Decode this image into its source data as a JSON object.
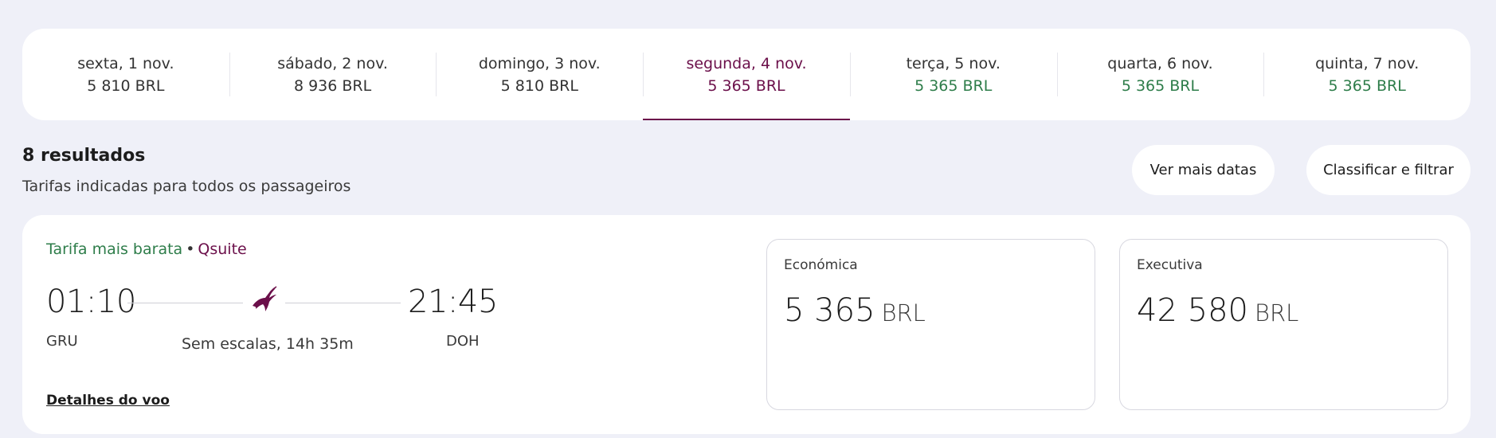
{
  "dates": [
    {
      "label": "sexta, 1 nov.",
      "price": "5 810 BRL",
      "selected": false,
      "lowest": false
    },
    {
      "label": "sábado, 2 nov.",
      "price": "8 936 BRL",
      "selected": false,
      "lowest": false
    },
    {
      "label": "domingo, 3 nov.",
      "price": "5 810 BRL",
      "selected": false,
      "lowest": false
    },
    {
      "label": "segunda, 4 nov.",
      "price": "5 365 BRL",
      "selected": true,
      "lowest": true
    },
    {
      "label": "terça, 5 nov.",
      "price": "5 365 BRL",
      "selected": false,
      "lowest": true
    },
    {
      "label": "quarta, 6 nov.",
      "price": "5 365 BRL",
      "selected": false,
      "lowest": true
    },
    {
      "label": "quinta, 7 nov.",
      "price": "5 365 BRL",
      "selected": false,
      "lowest": true
    }
  ],
  "results": {
    "count": "8 resultados",
    "subtitle": "Tarifas indicadas para todos os passageiros",
    "more_dates_label": "Ver mais datas",
    "sort_filter_label": "Classificar e filtrar"
  },
  "flight": {
    "tag_cheapest": "Tarifa mais barata",
    "tag_separator": "•",
    "tag_cabin": "Qsuite",
    "departure_time": "01:10",
    "arrival_time": "21:45",
    "departure_airport": "GRU",
    "arrival_airport": "DOH",
    "duration": "Sem escalas, 14h 35m",
    "details_link": "Detalhes do voo",
    "airline_icon": "oryx-logo-icon",
    "fares": [
      {
        "class": "Económica",
        "amount": "5 365",
        "currency": "BRL"
      },
      {
        "class": "Executiva",
        "amount": "42 580",
        "currency": "BRL"
      }
    ]
  },
  "colors": {
    "accent": "#6b0f4a",
    "lowest_price": "#2e7d4a",
    "background": "#eff0f8"
  }
}
